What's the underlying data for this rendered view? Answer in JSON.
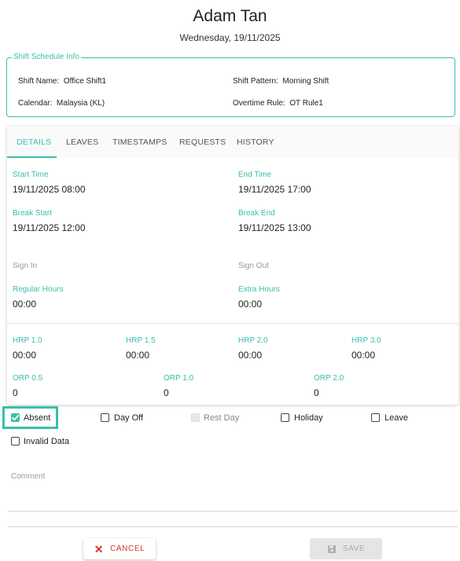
{
  "header": {
    "name": "Adam Tan",
    "date": "Wednesday, 19/11/2025"
  },
  "shift_info": {
    "legend": "Shift Schedule Info",
    "shift_name_label": "Shift Name:",
    "shift_name": "Office Shift1",
    "shift_pattern_label": "Shift Pattern:",
    "shift_pattern": "Morning Shift",
    "calendar_label": "Calendar:",
    "calendar": "Malaysia (KL)",
    "overtime_rule_label": "Overtime Rule:",
    "overtime_rule": "OT Rule1"
  },
  "tabs": [
    {
      "label": "DETAILS",
      "active": true
    },
    {
      "label": "LEAVES",
      "active": false
    },
    {
      "label": "TIMESTAMPS",
      "active": false
    },
    {
      "label": "REQUESTS",
      "active": false
    },
    {
      "label": "HISTORY",
      "active": false
    }
  ],
  "details": {
    "start_time_label": "Start Time",
    "start_time": "19/11/2025 08:00",
    "end_time_label": "End Time",
    "end_time": "19/11/2025 17:00",
    "break_start_label": "Break Start",
    "break_start": "19/11/2025 12:00",
    "break_end_label": "Break End",
    "break_end": "19/11/2025 13:00",
    "sign_in_label": "Sign In",
    "sign_in": "",
    "sign_out_label": "Sign Out",
    "sign_out": "",
    "regular_hours_label": "Regular Hours",
    "regular_hours": "00:00",
    "extra_hours_label": "Extra Hours",
    "extra_hours": "00:00",
    "hrp": [
      {
        "label": "HRP 1.0",
        "value": "00:00"
      },
      {
        "label": "HRP 1.5",
        "value": "00:00"
      },
      {
        "label": "HRP 2.0",
        "value": "00:00"
      },
      {
        "label": "HRP 3.0",
        "value": "00:00"
      }
    ],
    "orp": [
      {
        "label": "ORP 0.5",
        "value": "0"
      },
      {
        "label": "ORP 1.0",
        "value": "0"
      },
      {
        "label": "ORP 2.0",
        "value": "0"
      }
    ]
  },
  "checkboxes": [
    {
      "label": "Absent",
      "checked": true,
      "disabled": false
    },
    {
      "label": "Day Off",
      "checked": false,
      "disabled": false
    },
    {
      "label": "Rest Day",
      "checked": false,
      "disabled": true
    },
    {
      "label": "Holiday",
      "checked": false,
      "disabled": false
    },
    {
      "label": "Leave",
      "checked": false,
      "disabled": false
    },
    {
      "label": "Invalid Data",
      "checked": false,
      "disabled": false
    }
  ],
  "comment": {
    "label": "Comment",
    "value": ""
  },
  "actions": {
    "cancel_label": "CANCEL",
    "save_label": "SAVE"
  },
  "colors": {
    "accent": "#3bbfa9",
    "cancel": "#e0312a",
    "disabled": "#e5e5e5"
  },
  "icons": {
    "cancel": "close-icon",
    "save": "floppy-disk-icon",
    "check": "checkmark-icon"
  }
}
